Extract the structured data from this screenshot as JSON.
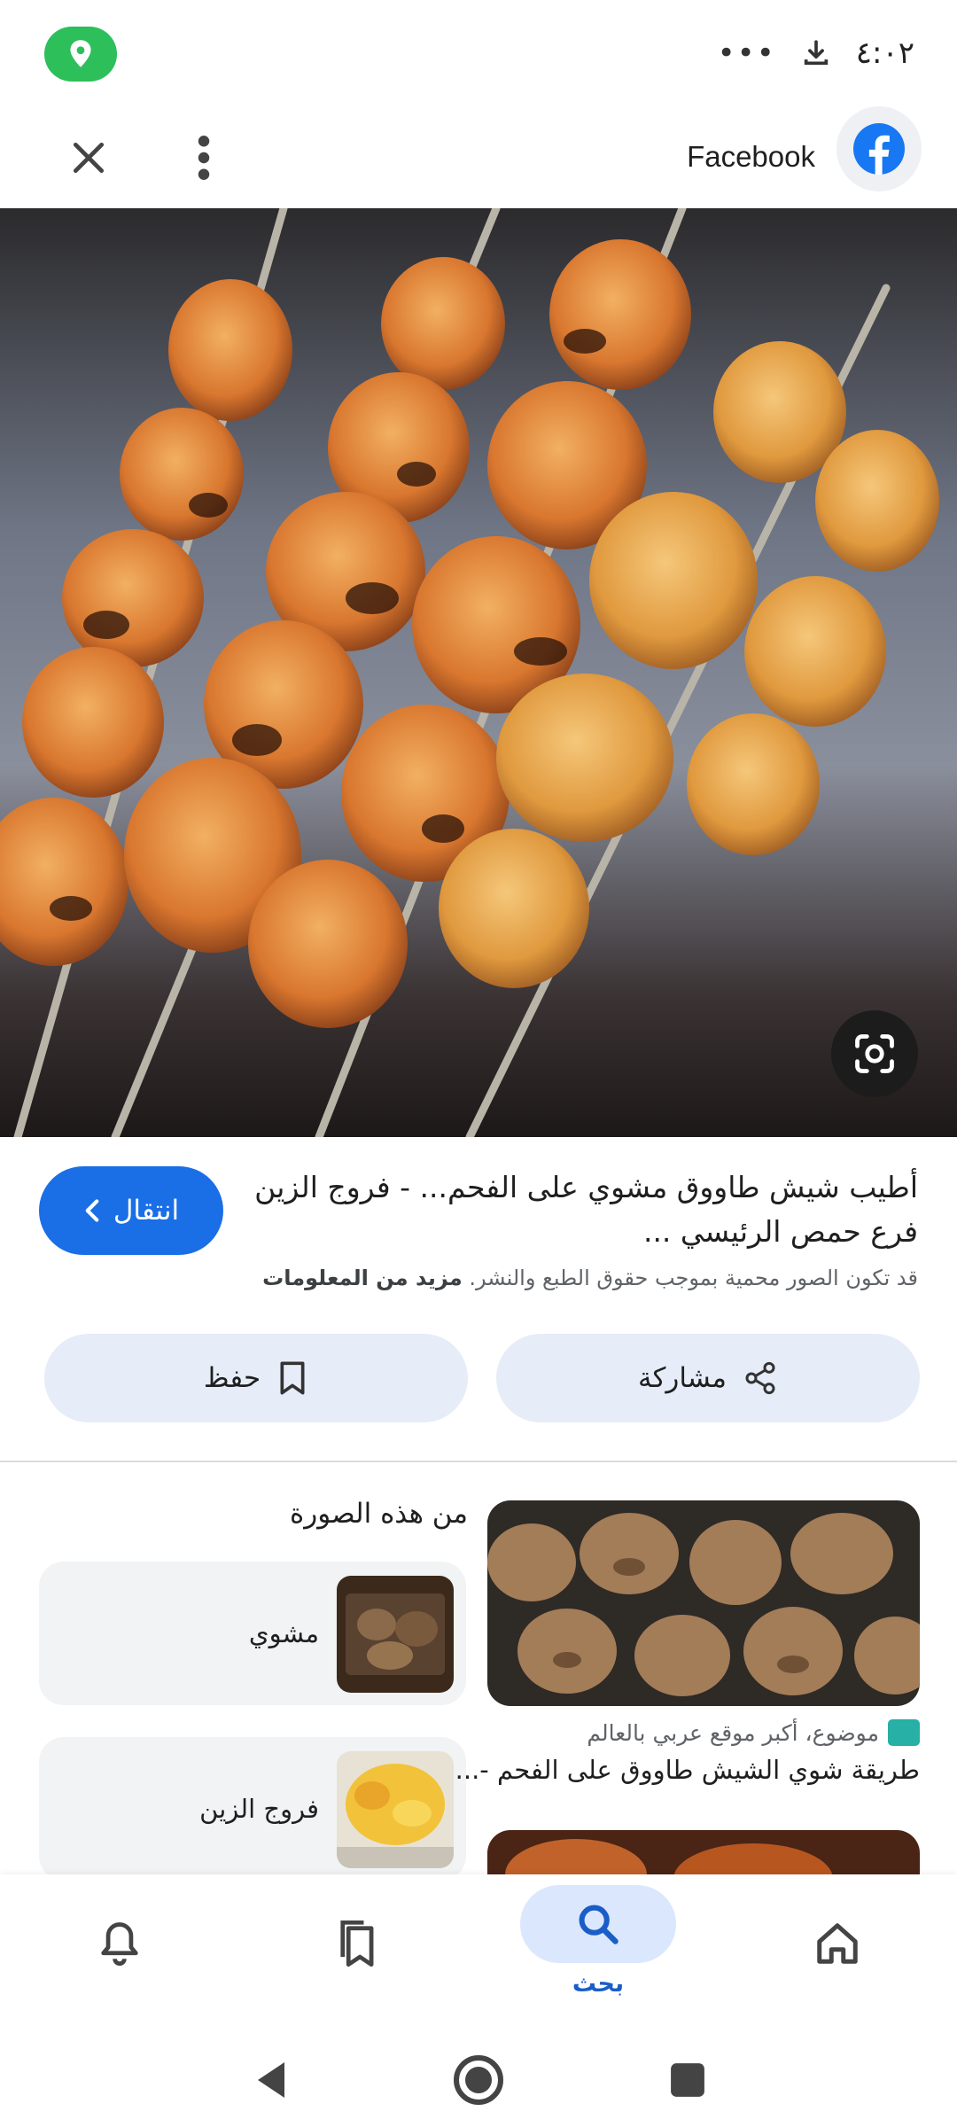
{
  "status_bar": {
    "time": "٤:٠٢",
    "more": "•••"
  },
  "top_bar": {
    "site_name": "Facebook"
  },
  "result": {
    "title": "أطيب شيش طاووق مشوي على الفحم... - فروج الزين فرع حمص الرئيسي ...",
    "visit_label": "انتقال",
    "copyright_text": "قد تكون الصور محمية بموجب حقوق الطبع والنشر.",
    "more_info_label": "مزيد من المعلومات"
  },
  "actions": {
    "share_label": "مشاركة",
    "save_label": "حفظ"
  },
  "related": {
    "heading": "من هذه الصورة",
    "items": [
      {
        "label": "مشوي"
      },
      {
        "label": "فروج الزين"
      }
    ]
  },
  "side_result": {
    "source": "موضوع، أكبر موقع عربي بالعالم",
    "title": "طريقة شوي الشيش طاووق على الفحم -..."
  },
  "bottom_nav": {
    "search_label": "بحث"
  },
  "colors": {
    "accent": "#1a6ee6",
    "pill": "#e6ecf8",
    "location_green": "#2cbf5a"
  }
}
